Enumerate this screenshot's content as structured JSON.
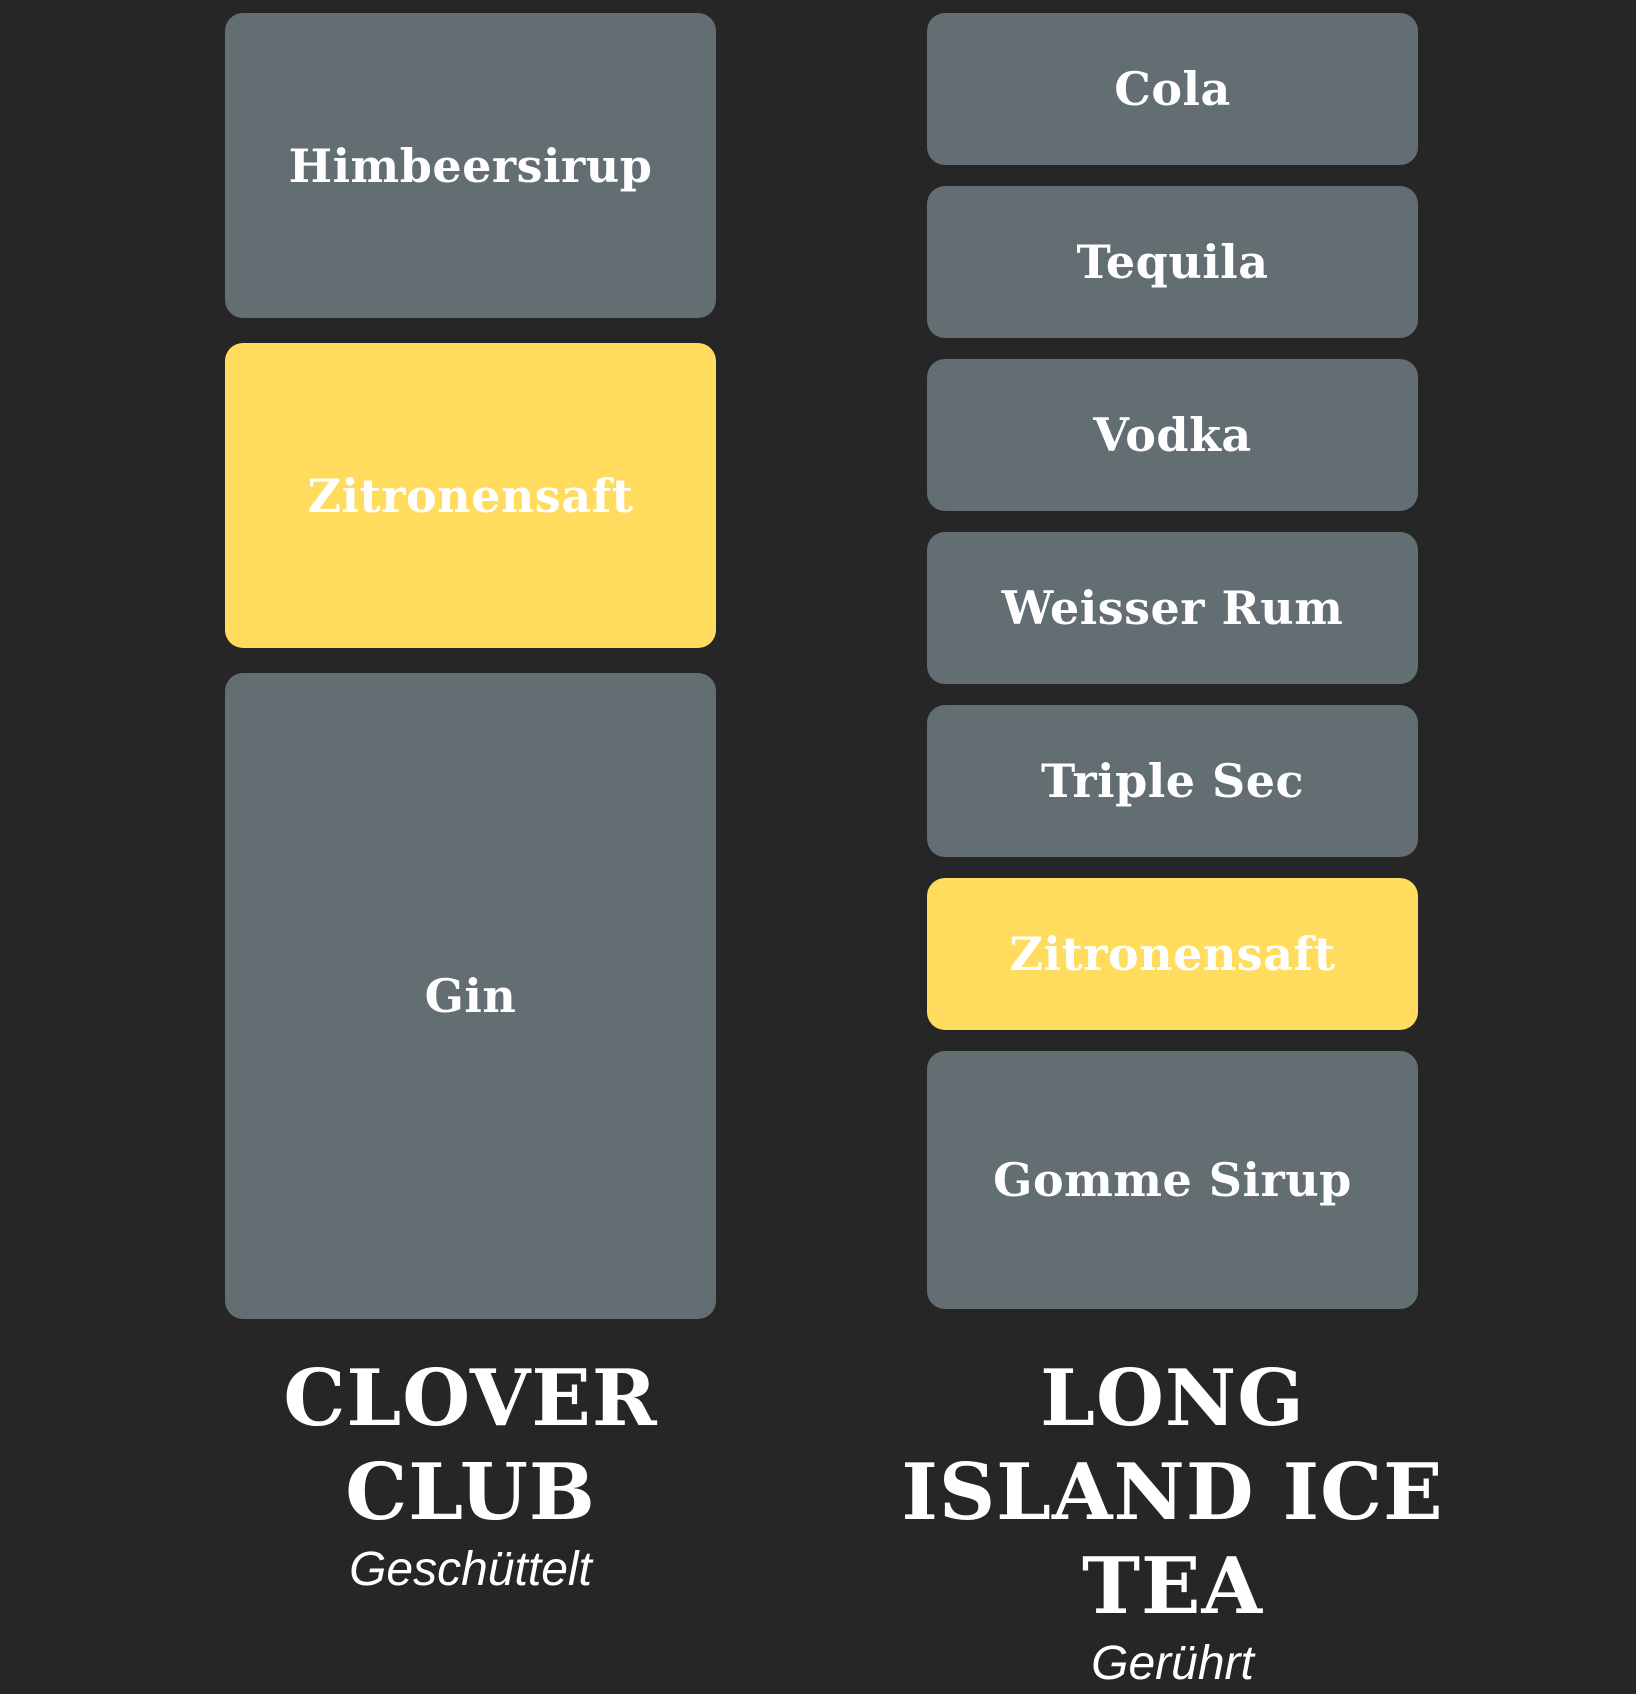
{
  "drinks": [
    {
      "name": "CLOVER CLUB",
      "method": "Geschüttelt",
      "layers": [
        {
          "label": "Himbeersirup",
          "color": "#636e73"
        },
        {
          "label": "Zitronensaft",
          "color": "#ffdc5e"
        },
        {
          "label": "Gin",
          "color": "#636e73"
        }
      ]
    },
    {
      "name": "LONG ISLAND ICE TEA",
      "method": "Gerührt",
      "layers": [
        {
          "label": "Cola",
          "color": "#636e73"
        },
        {
          "label": "Tequila",
          "color": "#636e73"
        },
        {
          "label": "Vodka",
          "color": "#636e73"
        },
        {
          "label": "Weisser Rum",
          "color": "#636e73"
        },
        {
          "label": "Triple Sec",
          "color": "#636e73"
        },
        {
          "label": "Zitronensaft",
          "color": "#ffdc5e"
        },
        {
          "label": "Gomme Sirup",
          "color": "#636e73"
        }
      ]
    }
  ],
  "colors": {
    "background": "#262626",
    "layer_default": "#636e73",
    "layer_highlight": "#ffdc5e",
    "text": "#ffffff"
  }
}
